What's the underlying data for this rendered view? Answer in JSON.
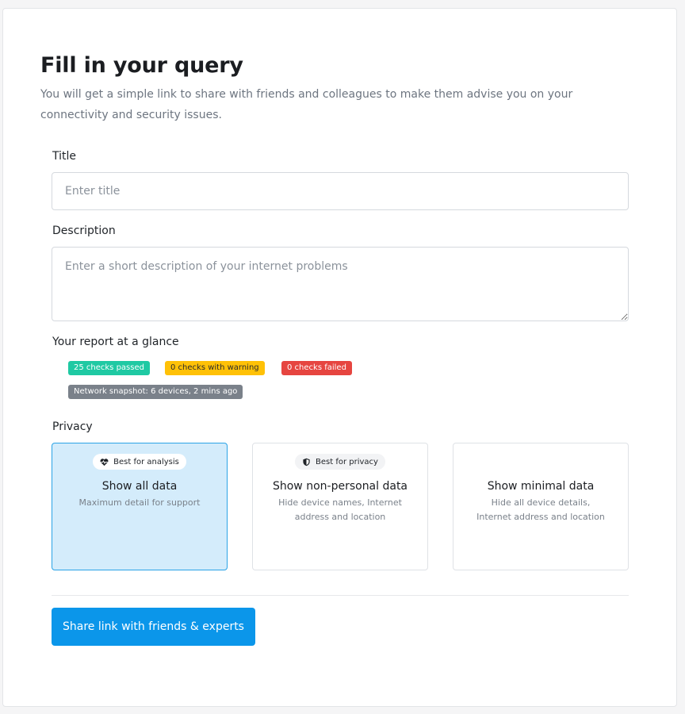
{
  "page": {
    "title": "Fill in your query",
    "subtitle": "You will get a simple link to share with friends and colleagues to make them advise you on your connectivity and security issues."
  },
  "form": {
    "title_label": "Title",
    "title_placeholder": "Enter title",
    "title_value": "",
    "description_label": "Description",
    "description_placeholder": "Enter a short description of your internet problems",
    "description_value": ""
  },
  "report": {
    "label": "Your report at a glance",
    "badges": {
      "passed": "25 checks passed",
      "warning": "0 checks with warning",
      "failed": "0 checks failed",
      "network": "Network snapshot: 6 devices, 2 mins ago"
    },
    "colors": {
      "passed": "#1fc9a3",
      "warning": "#ffc107",
      "failed": "#e64540",
      "network": "#7a818a"
    }
  },
  "privacy": {
    "label": "Privacy",
    "selected": "all",
    "options": [
      {
        "pill": "Best for analysis",
        "pill_icon": "heart-pulse-icon",
        "title": "Show all data",
        "description": "Maximum detail for support"
      },
      {
        "pill": "Best for privacy",
        "pill_icon": "shield-icon",
        "title": "Show non-personal data",
        "description": "Hide device names, Internet address and location"
      },
      {
        "title": "Show minimal data",
        "description": "Hide all device details, Internet address and location"
      }
    ]
  },
  "actions": {
    "share_label": "Share link with friends & experts",
    "accent_color": "#0b96ea"
  }
}
